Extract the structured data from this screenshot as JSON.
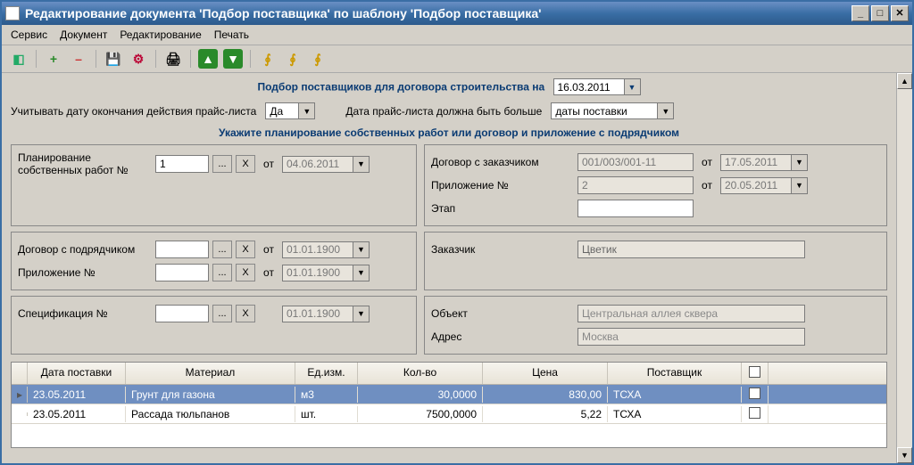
{
  "window": {
    "title": "Редактирование документа 'Подбор поставщика' по шаблону 'Подбор поставщика'"
  },
  "menu": {
    "service": "Сервис",
    "document": "Документ",
    "edit": "Редактирование",
    "print": "Печать"
  },
  "toolbar": {
    "new": "+",
    "delete": "–",
    "save": "💾",
    "db": "⚙",
    "printer": "🖨",
    "up": "▲",
    "down": "▼",
    "t1": "∮",
    "t2": "∮",
    "t3": "∮"
  },
  "header": {
    "text_prefix": "Подбор поставщиков для договора строительства на",
    "date": "16.03.2011"
  },
  "options": {
    "consider_price_end_label": "Учитывать дату окончания действия прайс-листа",
    "consider_value": "Да",
    "price_must_be_after_label": "Дата прайс-листа должна быть больше",
    "price_must_be_after_value": "даты поставки"
  },
  "hint": "Укажите планирование собственных работ или договор и приложение с подрядчиком",
  "left_panel": {
    "own_plan_label": "Планирование собственных работ №",
    "own_plan_value": "1",
    "own_plan_from": "04.06.2011",
    "contractor_contract_label": "Договор с подрядчиком",
    "contractor_contract_from": "01.01.1900",
    "appendix_label": "Приложение №",
    "appendix_from": "01.01.1900",
    "spec_label": "Спецификация №",
    "spec_from": "01.01.1900",
    "from_text": "от",
    "dots": "...",
    "x": "X"
  },
  "right_panel": {
    "customer_contract_label": "Договор с заказчиком",
    "customer_contract_value": "001/003/001-11",
    "customer_contract_from": "17.05.2011",
    "appendix_label": "Приложение №",
    "appendix_value": "2",
    "appendix_from": "20.05.2011",
    "stage_label": "Этап",
    "customer_label": "Заказчик",
    "customer_value": "Цветик",
    "object_label": "Объект",
    "object_value": "Центральная аллея сквера",
    "address_label": "Адрес",
    "address_value": "Москва",
    "from_text": "от"
  },
  "grid": {
    "columns": {
      "date": "Дата поставки",
      "material": "Материал",
      "unit": "Ед.изм.",
      "qty": "Кол-во",
      "price": "Цена",
      "supplier": "Поставщик"
    },
    "rows": [
      {
        "date": "23.05.2011",
        "material": "Грунт для газона",
        "unit": "м3",
        "qty": "30,0000",
        "price": "830,00",
        "supplier": "ТСХА",
        "selected": true
      },
      {
        "date": "23.05.2011",
        "material": "Рассада тюльпанов",
        "unit": "шт.",
        "qty": "7500,0000",
        "price": "5,22",
        "supplier": "ТСХА",
        "selected": false
      }
    ]
  }
}
